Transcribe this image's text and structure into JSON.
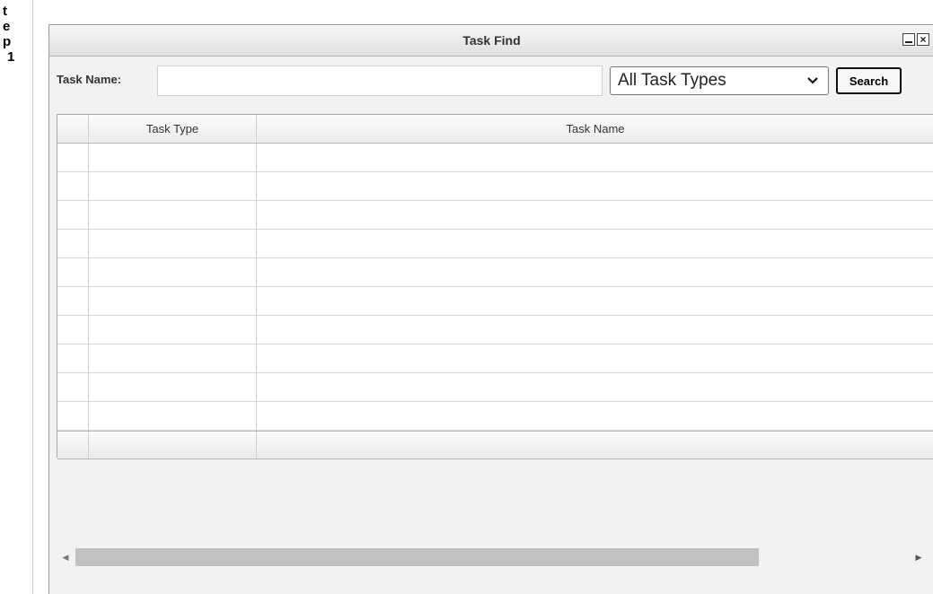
{
  "side": {
    "letters": [
      "t",
      "e",
      "p",
      "1"
    ],
    "hint": ""
  },
  "dialog": {
    "title": "Task Find",
    "minimize_symbol": "_",
    "close_symbol": "×",
    "search": {
      "name_label": "Task Name:",
      "name_value": "",
      "name_placeholder": "",
      "type_selected": "All Task Types",
      "button_label": "Search"
    },
    "grid": {
      "columns": [
        "",
        "Task Type",
        "Task Name"
      ],
      "rows": [
        [
          "",
          "",
          ""
        ],
        [
          "",
          "",
          ""
        ],
        [
          "",
          "",
          ""
        ],
        [
          "",
          "",
          ""
        ],
        [
          "",
          "",
          ""
        ],
        [
          "",
          "",
          ""
        ],
        [
          "",
          "",
          ""
        ],
        [
          "",
          "",
          ""
        ],
        [
          "",
          "",
          ""
        ],
        [
          "",
          "",
          ""
        ]
      ]
    },
    "scrollbar": {
      "left_arrow": "◀",
      "right_arrow": "▶"
    }
  },
  "icons": {
    "dropdown": "chevron-down-icon",
    "minimize": "minimize-icon",
    "close": "close-icon"
  },
  "colors": {
    "dialog_bg": "#f2f2f2",
    "grid_border": "#d6d6d6",
    "scroll_thumb": "#c1c1c1"
  }
}
